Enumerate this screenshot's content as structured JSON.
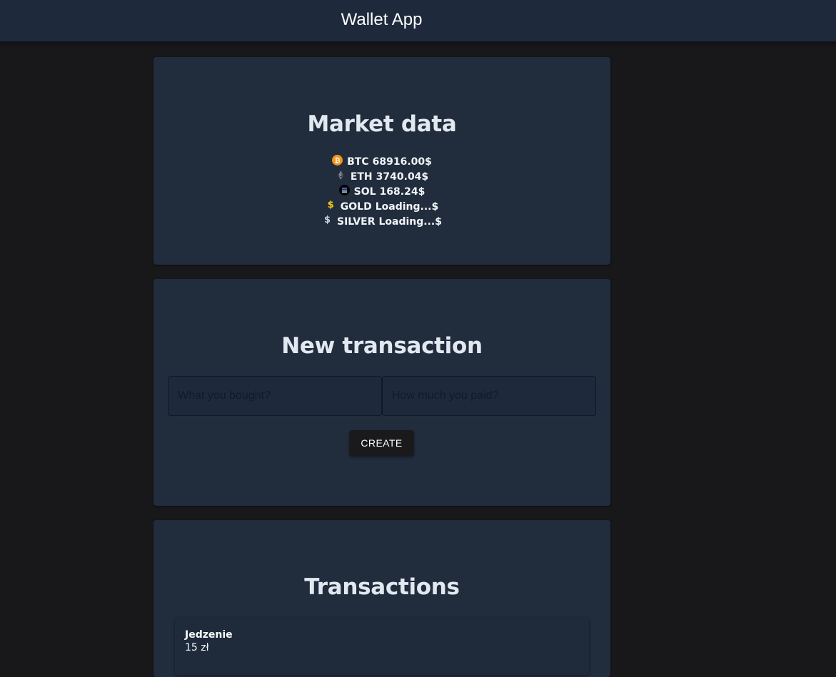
{
  "header": {
    "title": "Wallet App"
  },
  "market": {
    "title": "Market data",
    "rows": [
      {
        "icon": "bitcoin-icon",
        "symbol": "BTC",
        "price": "68916.00$"
      },
      {
        "icon": "ethereum-icon",
        "symbol": "ETH",
        "price": "3740.04$"
      },
      {
        "icon": "solana-icon",
        "symbol": "SOL",
        "price": "168.24$"
      },
      {
        "icon": "gold-dollar-icon",
        "symbol": "GOLD",
        "price": "Loading...$"
      },
      {
        "icon": "silver-dollar-icon",
        "symbol": "SILVER",
        "price": "Loading...$"
      }
    ]
  },
  "new_transaction": {
    "title": "New transaction",
    "item_input": {
      "value": "",
      "placeholder": "What you bought?"
    },
    "amount_input": {
      "value": "",
      "placeholder": "How much you paid?"
    },
    "create_label": "CREATE"
  },
  "transactions": {
    "title": "Transactions",
    "items": [
      {
        "name": "Jedzenie",
        "amount": "15 zł"
      }
    ]
  },
  "colors": {
    "background": "#18181b",
    "header": "#1e293b",
    "card": "#212d3d",
    "button": "#1a1a1c",
    "bitcoin": "#f7931a",
    "gold": "#facc15",
    "silver": "#cbd5e1"
  }
}
